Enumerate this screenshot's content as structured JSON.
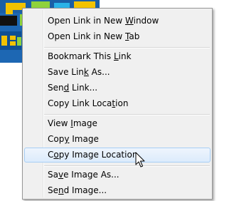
{
  "menu": {
    "items": [
      {
        "pre": "Open Link in New ",
        "key": "W",
        "post": "indow"
      },
      {
        "pre": "Open Link in New ",
        "key": "T",
        "post": "ab"
      },
      {
        "pre": "Bookmark This ",
        "key": "L",
        "post": "ink"
      },
      {
        "pre": "Save Lin",
        "key": "k",
        "post": " As..."
      },
      {
        "pre": "Sen",
        "key": "d",
        "post": " Link..."
      },
      {
        "pre": "Copy Link Loca",
        "key": "t",
        "post": "ion"
      },
      {
        "pre": "View ",
        "key": "I",
        "post": "mage"
      },
      {
        "pre": "Cop",
        "key": "y",
        "post": " Image"
      },
      {
        "pre": "C",
        "key": "o",
        "post": "py Image Location"
      },
      {
        "pre": "Sa",
        "key": "v",
        "post": "e Image As..."
      },
      {
        "pre": "Se",
        "key": "n",
        "post": "d Image..."
      }
    ],
    "highlighted_index": 8
  },
  "colors": {
    "menu_background": "#f0f0f0",
    "highlight_border": "#a7cef5",
    "background_image": "#1d67b3"
  }
}
